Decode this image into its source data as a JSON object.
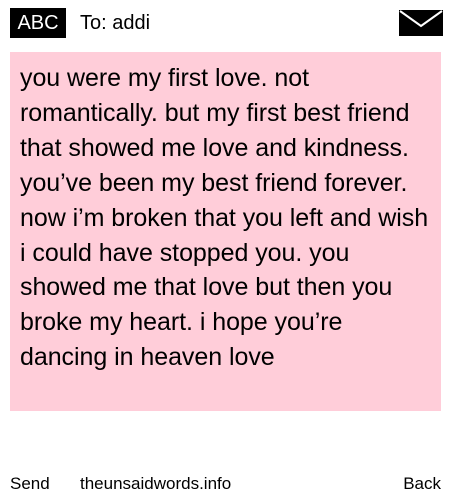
{
  "header": {
    "badge_label": "ABC",
    "to_line": "To: addi",
    "envelope_icon": "envelope-icon"
  },
  "message": {
    "body": "you were my first love. not romantically. but my first best friend that showed me love and kindness. you’ve been my best friend forever. now i’m broken that you left and wish i could have stopped you. you showed me that love but then you broke my heart. i hope you’re dancing in heaven love"
  },
  "footer": {
    "send_label": "Send",
    "site_label": "theunsaidwords.info",
    "back_label": "Back"
  },
  "colors": {
    "message_background": "#ffcdd9",
    "badge_background": "#000000",
    "badge_text": "#ffffff",
    "page_background": "#ffffff"
  }
}
